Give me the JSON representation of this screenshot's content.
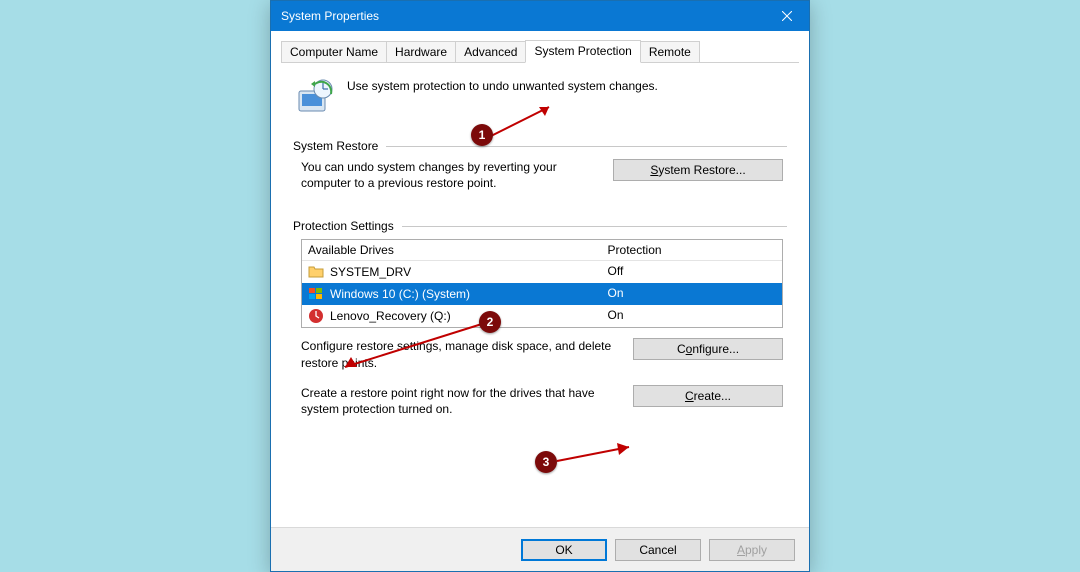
{
  "window": {
    "title": "System Properties"
  },
  "tabs": {
    "computer_name": "Computer Name",
    "hardware": "Hardware",
    "advanced": "Advanced",
    "system_protection": "System Protection",
    "remote": "Remote"
  },
  "intro_text": "Use system protection to undo unwanted system changes.",
  "system_restore": {
    "label": "System Restore",
    "description": "You can undo system changes by reverting your computer to a previous restore point.",
    "button": "System Restore..."
  },
  "protection_settings": {
    "label": "Protection Settings",
    "header_drives": "Available Drives",
    "header_protection": "Protection",
    "drives": [
      {
        "name": "SYSTEM_DRV",
        "protection": "Off",
        "icon": "folder",
        "selected": false
      },
      {
        "name": "Windows 10 (C:) (System)",
        "protection": "On",
        "icon": "windows",
        "selected": true
      },
      {
        "name": "Lenovo_Recovery (Q:)",
        "protection": "On",
        "icon": "recovery",
        "selected": false
      }
    ],
    "configure_desc": "Configure restore settings, manage disk space, and delete restore points.",
    "configure_button": "Configure...",
    "create_desc": "Create a restore point right now for the drives that have system protection turned on.",
    "create_button": "Create..."
  },
  "footer": {
    "ok": "OK",
    "cancel": "Cancel",
    "apply": "Apply"
  },
  "annotations": {
    "step1": "1",
    "step2": "2",
    "step3": "3"
  }
}
